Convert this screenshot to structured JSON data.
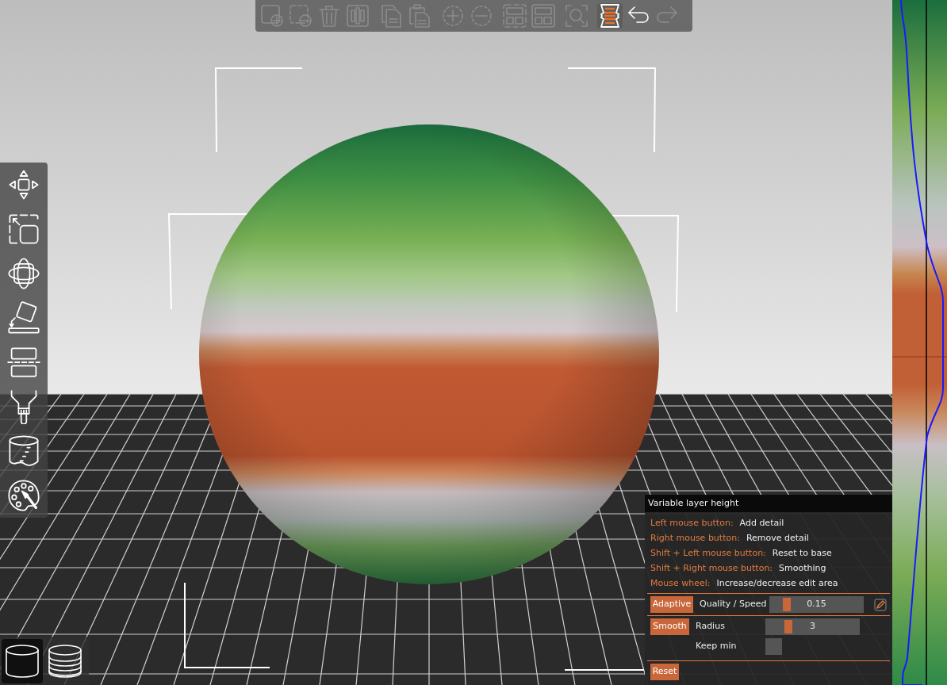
{
  "top_toolbar": [
    {
      "kind": "add",
      "disabled": true,
      "selected": false
    },
    {
      "kind": "delete",
      "disabled": true,
      "selected": false
    },
    {
      "kind": "delete_all",
      "disabled": true,
      "selected": false
    },
    {
      "kind": "arrange",
      "disabled": true,
      "selected": false
    },
    {
      "kind": "copy",
      "disabled": true,
      "selected": false
    },
    {
      "kind": "paste",
      "disabled": true,
      "selected": false
    },
    {
      "kind": "add_instance",
      "disabled": true,
      "selected": false
    },
    {
      "kind": "remove_instance",
      "disabled": true,
      "selected": false
    },
    {
      "kind": "split_objects",
      "disabled": true,
      "selected": false
    },
    {
      "kind": "split_parts",
      "disabled": true,
      "selected": false
    },
    {
      "kind": "search",
      "disabled": true,
      "selected": false
    },
    {
      "kind": "layers",
      "disabled": false,
      "selected": true
    },
    {
      "kind": "undo",
      "disabled": false,
      "selected": false
    },
    {
      "kind": "redo",
      "disabled": true,
      "selected": false
    }
  ],
  "left_toolbar": [
    {
      "kind": "move"
    },
    {
      "kind": "scale"
    },
    {
      "kind": "rotate"
    },
    {
      "kind": "place_on_face"
    },
    {
      "kind": "cut"
    },
    {
      "kind": "supports"
    },
    {
      "kind": "seam"
    },
    {
      "kind": "paint"
    }
  ],
  "view_toggle": [
    {
      "kind": "volumes",
      "selected": true
    },
    {
      "kind": "layers",
      "selected": false
    }
  ],
  "layer_panel": {
    "title": "Variable layer height",
    "hints": [
      {
        "key": "Left mouse button:",
        "action": "Add detail"
      },
      {
        "key": "Right mouse button:",
        "action": "Remove detail"
      },
      {
        "key": "Shift + Left mouse button:",
        "action": "Reset to base"
      },
      {
        "key": "Shift + Right mouse button:",
        "action": "Smoothing"
      },
      {
        "key": "Mouse wheel:",
        "action": "Increase/decrease edit area"
      }
    ],
    "adaptive": {
      "button": "Adaptive",
      "label": "Quality / Speed",
      "level": 0.16,
      "value": "0.15"
    },
    "smooth": {
      "button": "Smooth",
      "label": "Radius",
      "level": 0.22,
      "value": "3",
      "keep_min_label": "Keep min",
      "keep_min_checked": false
    },
    "reset": "Reset"
  }
}
